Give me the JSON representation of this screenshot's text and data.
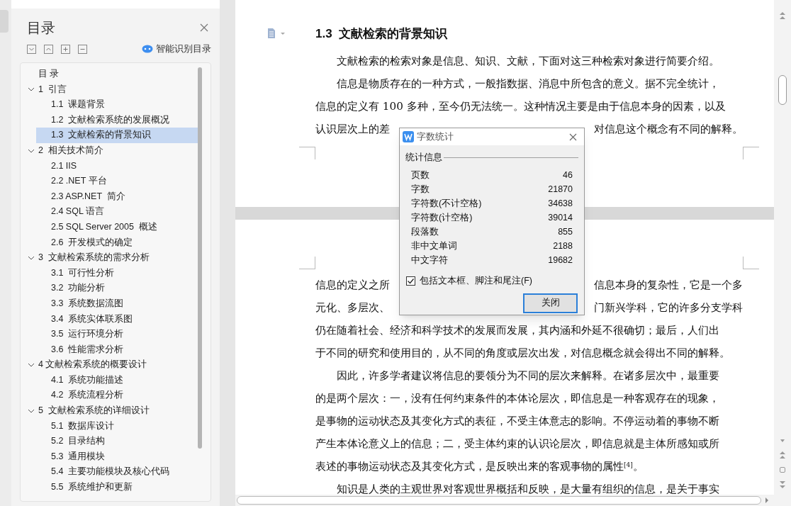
{
  "sidebar": {
    "title": "目录",
    "smart_button": "智能识别目录",
    "tree": [
      {
        "label": "目 录",
        "selected": false
      },
      {
        "label": "1  引言",
        "selected": false,
        "expanded": true,
        "children": [
          {
            "label": "1.1  课题背景",
            "selected": false
          },
          {
            "label": "1.2  文献检索系统的发展概况",
            "selected": false
          },
          {
            "label": "1.3  文献检索的背景知识",
            "selected": true
          }
        ]
      },
      {
        "label": "2  相关技术简介",
        "selected": false,
        "expanded": true,
        "children": [
          {
            "label": "2.1 IIS",
            "selected": false
          },
          {
            "label": "2.2 .NET 平台",
            "selected": false
          },
          {
            "label": "2.3 ASP.NET  简介",
            "selected": false
          },
          {
            "label": "2.4 SQL 语言",
            "selected": false
          },
          {
            "label": "2.5 SQL Server 2005  概述",
            "selected": false
          },
          {
            "label": "2.6  开发模式的确定",
            "selected": false
          }
        ]
      },
      {
        "label": "3  文献检索系统的需求分析",
        "selected": false,
        "expanded": true,
        "children": [
          {
            "label": "3.1  可行性分析",
            "selected": false
          },
          {
            "label": "3.2  功能分析",
            "selected": false
          },
          {
            "label": "3.3  系统数据流图",
            "selected": false
          },
          {
            "label": "3.4  系统实体联系图",
            "selected": false
          },
          {
            "label": "3.5  运行环境分析",
            "selected": false
          },
          {
            "label": "3.6  性能需求分析",
            "selected": false
          }
        ]
      },
      {
        "label": "4 文献检索系统的概要设计",
        "selected": false,
        "expanded": true,
        "children": [
          {
            "label": "4.1  系统功能描述",
            "selected": false
          },
          {
            "label": "4.2  系统流程分析",
            "selected": false
          }
        ]
      },
      {
        "label": "5  文献检索系统的详细设计",
        "selected": false,
        "expanded": true,
        "children": [
          {
            "label": "5.1  数据库设计",
            "selected": false
          },
          {
            "label": "5.2  目录结构",
            "selected": false
          },
          {
            "label": "5.3  通用模块",
            "selected": false
          },
          {
            "label": "5.4  主要功能模块及核心代码",
            "selected": false
          },
          {
            "label": "5.5  系统维护和更新",
            "selected": false
          }
        ]
      }
    ]
  },
  "document": {
    "heading": "1.3  文献检索的背景知识",
    "page_1_lines": [
      {
        "text": "文献检索的检索对象是信息、知识、文献，下面对这三种检索对象进行简要介绍。",
        "first": true
      },
      {
        "text": "信息是物质存在的一种方式，一般指数据、消息中所包含的意义。据不完全统计，",
        "first": true
      },
      {
        "text": "信息的定义有 100 多种，至今仍无法统一。这种情况主要是由于信息本身的因素，以及",
        "first": false
      },
      {
        "left": "认识层次上的差",
        "right": "对信息这个概念有不同的解释。",
        "first": false
      }
    ],
    "page_2_lines": [
      {
        "left": "信息的定义之所",
        "right": "信息本身的复杂性，它是一个多",
        "first": false
      },
      {
        "left": "元化、多层次、",
        "right": "门新兴学科，它的许多分支学科",
        "first": false
      },
      {
        "text": "仍在随着社会、经济和科学技术的发展而发展，其内涵和外延不很确切；最后，人们出",
        "first": false
      },
      {
        "text": "于不同的研究和使用目的，从不同的角度或层次出发，对信息概念就会得出不同的解释。",
        "first": false
      },
      {
        "text": "因此，许多学者建议将信息的要领分为不同的层次来解释。在诸多层次中，最重要",
        "first": true
      },
      {
        "text": "的是两个层次：一，没有任何约束条件的本体论层次，即信息是一种客观存在的现象，",
        "first": false
      },
      {
        "text": "是事物的运动状态及其变化方式的表征，不受主体意志的影响。不停运动着的事物不断",
        "first": false
      },
      {
        "text": "产生本体论意义上的信息；二，受主体约束的认识论层次，即信息就是主体所感知或所",
        "first": false
      },
      {
        "text": "表述的事物运动状态及其变化方式，是反映出来的客观事物的属性$^{[4]}$。",
        "first": false
      },
      {
        "text": "知识是人类的主观世界对客观世界概括和反映，是大量有组织的信息，是关于事实",
        "first": true
      }
    ]
  },
  "dialog": {
    "title": "字数统计",
    "group": "统计信息",
    "stats": [
      {
        "label": "页数",
        "value": "46"
      },
      {
        "label": "字数",
        "value": "21870"
      },
      {
        "label": "字符数(不计空格)",
        "value": "34638"
      },
      {
        "label": "字符数(计空格)",
        "value": "39014"
      },
      {
        "label": "段落数",
        "value": "855"
      },
      {
        "label": "非中文单词",
        "value": "2188"
      },
      {
        "label": "中文字符",
        "value": "19682"
      }
    ],
    "checkbox": {
      "label": "包括文本框、脚注和尾注(F)",
      "checked": true
    },
    "button": "关闭"
  }
}
